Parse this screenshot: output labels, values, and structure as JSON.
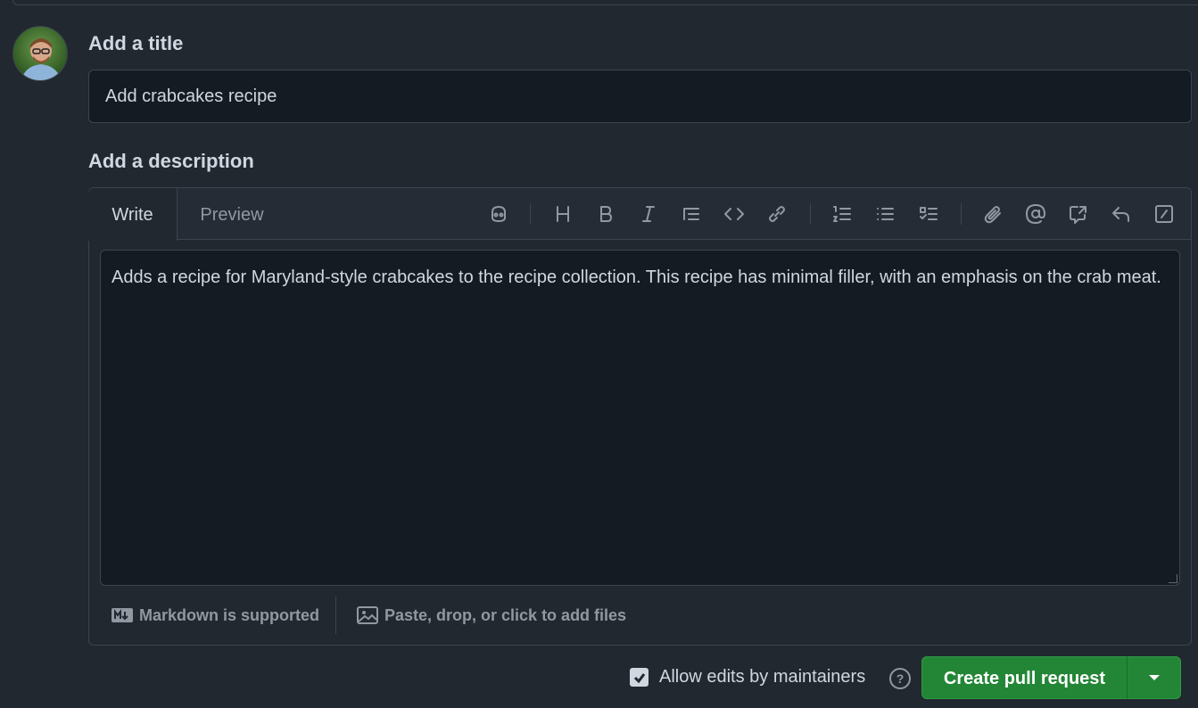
{
  "form": {
    "title_label": "Add a title",
    "title_value": "Add crabcakes recipe",
    "description_label": "Add a description"
  },
  "editor": {
    "tabs": [
      {
        "label": "Write",
        "active": true
      },
      {
        "label": "Preview",
        "active": false
      }
    ],
    "toolbar_icons": [
      "copilot-icon",
      "heading-icon",
      "bold-icon",
      "italic-icon",
      "quote-icon",
      "code-icon",
      "link-icon",
      "ordered-list-icon",
      "unordered-list-icon",
      "task-list-icon",
      "attach-icon",
      "mention-icon",
      "cross-reference-icon",
      "saved-reply-icon",
      "slash-command-icon"
    ],
    "body": "Adds a recipe for Maryland-style crabcakes to the recipe collection. This recipe has minimal filler, with an emphasis on the crab meat.",
    "footer": {
      "markdown_note": "Markdown is supported",
      "attach_note": "Paste, drop, or click to add files"
    }
  },
  "actions": {
    "allow_edits_label": "Allow edits by maintainers",
    "allow_edits_checked": true,
    "help_glyph": "?",
    "create_button_label": "Create pull request"
  },
  "colors": {
    "background": "#212830",
    "primary_button": "#238636"
  }
}
